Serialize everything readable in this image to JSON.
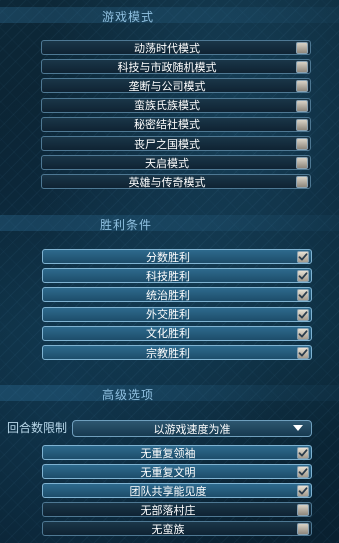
{
  "sections": {
    "game_modes": {
      "title": "游戏模式"
    },
    "victory": {
      "title": "胜利条件"
    },
    "advanced": {
      "title": "高级选项"
    }
  },
  "game_modes": [
    {
      "label": "动荡时代模式",
      "checked": false
    },
    {
      "label": "科技与市政随机模式",
      "checked": false
    },
    {
      "label": "垄断与公司模式",
      "checked": false
    },
    {
      "label": "蛮族氏族模式",
      "checked": false
    },
    {
      "label": "秘密结社模式",
      "checked": false
    },
    {
      "label": "丧尸之国模式",
      "checked": false
    },
    {
      "label": "天启模式",
      "checked": false
    },
    {
      "label": "英雄与传奇模式",
      "checked": false
    }
  ],
  "victory_conditions": [
    {
      "label": "分数胜利",
      "checked": true
    },
    {
      "label": "科技胜利",
      "checked": true
    },
    {
      "label": "统治胜利",
      "checked": true
    },
    {
      "label": "外交胜利",
      "checked": true
    },
    {
      "label": "文化胜利",
      "checked": true
    },
    {
      "label": "宗教胜利",
      "checked": true
    }
  ],
  "turn_limit": {
    "label": "回合数限制",
    "value": "以游戏速度为准"
  },
  "advanced_options": [
    {
      "label": "无重复领袖",
      "checked": true
    },
    {
      "label": "无重复文明",
      "checked": true
    },
    {
      "label": "团队共享能见度",
      "checked": true
    },
    {
      "label": "无部落村庄",
      "checked": false
    },
    {
      "label": "无蛮族",
      "checked": false
    }
  ],
  "colors": {
    "header_text": "#8fc0e0",
    "row_on": "#2e6a8d",
    "row_off": "#1a3648",
    "checkmark": "#2a3c4c"
  }
}
